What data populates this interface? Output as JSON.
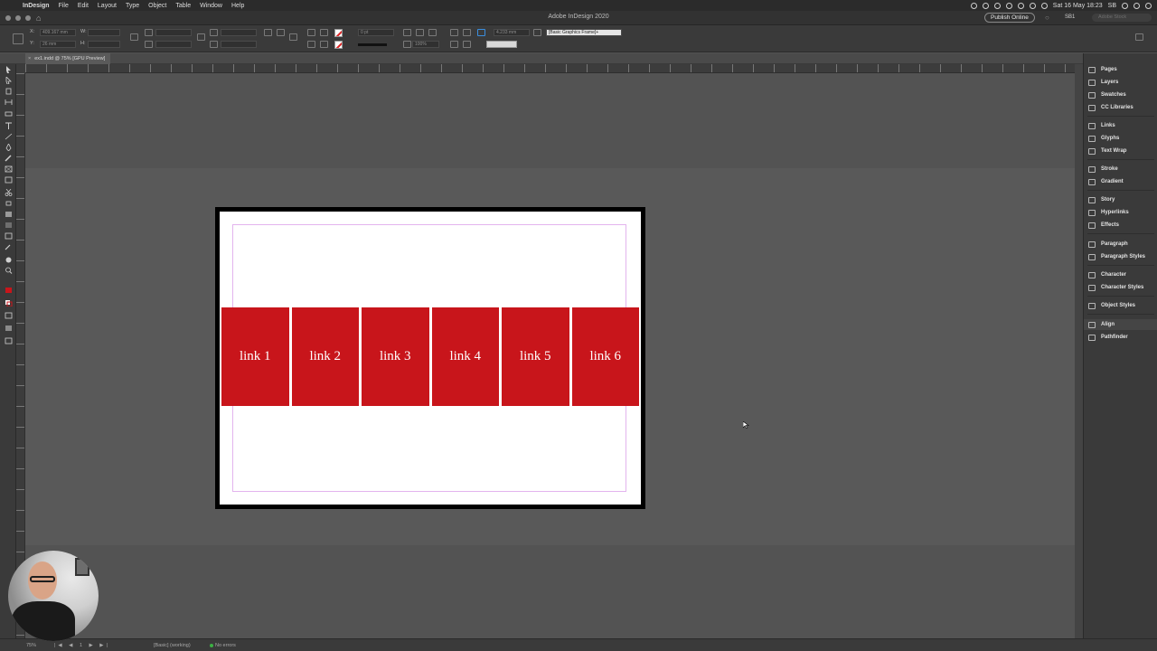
{
  "menubar": {
    "app_name": "InDesign",
    "items": [
      "File",
      "Edit",
      "Layout",
      "Type",
      "Object",
      "Table",
      "Window",
      "Help"
    ],
    "clock": "Sat 16 May 18:23",
    "user_initials": "SB"
  },
  "titlebar": {
    "title": "Adobe InDesign 2020",
    "publish_label": "Publish Online",
    "workspace_label": "SB1",
    "search_placeholder": "Adobe Stock"
  },
  "control": {
    "x_label": "X:",
    "x_value": "409.167 mm",
    "y_label": "Y:",
    "y_value": "26 mm",
    "w_label": "W:",
    "h_label": "H:",
    "stroke_weight": "0 pt",
    "scale_percent": "100%",
    "offset_value": "4.233 mm",
    "object_style": "[Basic Graphics Frame]+"
  },
  "document": {
    "tab_label": "ex1.indd @ 75% [GPU Preview]",
    "links": [
      "link 1",
      "link 2",
      "link 3",
      "link 4",
      "link 5",
      "link 6"
    ],
    "link_color": "#c8151b"
  },
  "panels": [
    {
      "label": "Pages",
      "icon": "pages-icon"
    },
    {
      "label": "Layers",
      "icon": "layers-icon"
    },
    {
      "label": "Swatches",
      "icon": "swatches-icon"
    },
    {
      "label": "CC Libraries",
      "icon": "cc-libraries-icon"
    },
    {
      "label": "Links",
      "icon": "links-icon"
    },
    {
      "label": "Glyphs",
      "icon": "glyphs-icon"
    },
    {
      "label": "Text Wrap",
      "icon": "text-wrap-icon"
    },
    {
      "label": "Stroke",
      "icon": "stroke-icon"
    },
    {
      "label": "Gradient",
      "icon": "gradient-icon"
    },
    {
      "label": "Story",
      "icon": "story-icon"
    },
    {
      "label": "Hyperlinks",
      "icon": "hyperlinks-icon"
    },
    {
      "label": "Effects",
      "icon": "effects-icon"
    },
    {
      "label": "Paragraph",
      "icon": "paragraph-icon"
    },
    {
      "label": "Paragraph Styles",
      "icon": "paragraph-styles-icon"
    },
    {
      "label": "Character",
      "icon": "character-icon"
    },
    {
      "label": "Character Styles",
      "icon": "character-styles-icon"
    },
    {
      "label": "Object Styles",
      "icon": "object-styles-icon"
    },
    {
      "label": "Align",
      "icon": "align-icon"
    },
    {
      "label": "Pathfinder",
      "icon": "pathfinder-icon"
    }
  ],
  "status": {
    "zoom": "75%",
    "page": "1",
    "profile": "[Basic] (working)",
    "errors": "No errors"
  }
}
